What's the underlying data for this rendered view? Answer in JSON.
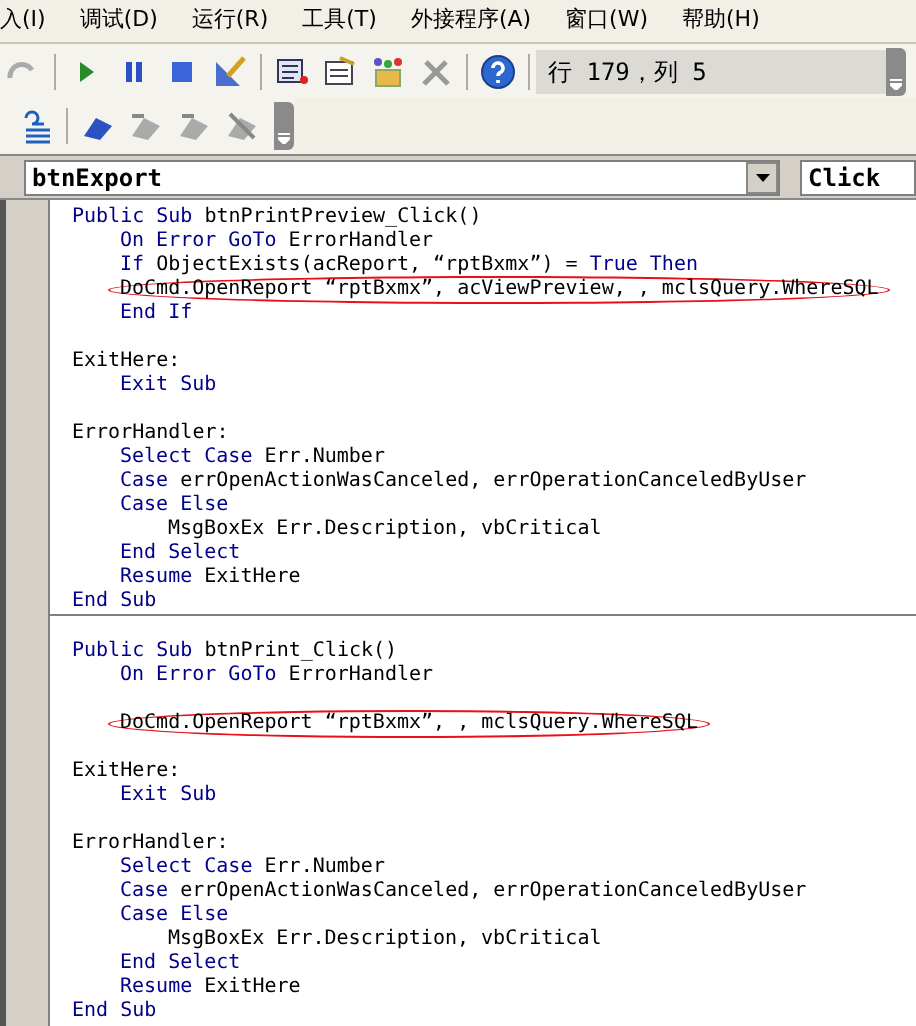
{
  "menu": [
    "入(I)",
    "调试(D)",
    "运行(R)",
    "工具(T)",
    "外接程序(A)",
    "窗口(W)",
    "帮助(H)"
  ],
  "toolbar": {
    "position": "行 179，列 5"
  },
  "object_combo": {
    "value": "btnExport"
  },
  "procedure_combo": {
    "value": "Click"
  },
  "procedures": [
    {
      "lines": [
        {
          "segments": [
            {
              "kind": "kw",
              "text": "Public Sub"
            },
            {
              "kind": "tx",
              "text": " btnPrintPreview_Click()"
            }
          ],
          "children": [
            {
              "segments": [
                {
                  "kind": "kw",
                  "text": "On Error GoTo"
                },
                {
                  "kind": "tx",
                  "text": " ErrorHandler"
                }
              ]
            },
            {
              "segments": [
                {
                  "kind": "kw",
                  "text": "If"
                },
                {
                  "kind": "tx",
                  "text": " ObjectExists(acReport, “rptBxmx”) = "
                },
                {
                  "kind": "kw",
                  "text": "True Then"
                }
              ]
            },
            {
              "circled": true,
              "segments": [
                {
                  "kind": "tx",
                  "text": "DoCmd.OpenReport “rptBxmx”, acViewPreview, , mclsQuery.WhereSQL"
                }
              ]
            },
            {
              "segments": [
                {
                  "kind": "kw",
                  "text": "End If"
                }
              ]
            }
          ]
        },
        {
          "blank_before": true,
          "segments": [
            {
              "kind": "tx",
              "text": "ExitHere:"
            }
          ],
          "children": [
            {
              "segments": [
                {
                  "kind": "kw",
                  "text": "Exit Sub"
                }
              ]
            }
          ]
        },
        {
          "blank_before": true,
          "segments": [
            {
              "kind": "tx",
              "text": "ErrorHandler:"
            }
          ],
          "children": [
            {
              "segments": [
                {
                  "kind": "kw",
                  "text": "Select Case"
                },
                {
                  "kind": "tx",
                  "text": " Err.Number"
                }
              ]
            },
            {
              "segments": [
                {
                  "kind": "kw",
                  "text": "Case"
                },
                {
                  "kind": "tx",
                  "text": " errOpenActionWasCanceled, errOperationCanceledByUser"
                }
              ]
            },
            {
              "segments": [
                {
                  "kind": "kw",
                  "text": "Case Else"
                }
              ],
              "children": [
                {
                  "segments": [
                    {
                      "kind": "tx",
                      "text": "MsgBoxEx Err.Description, vbCritical"
                    }
                  ]
                }
              ]
            },
            {
              "segments": [
                {
                  "kind": "kw",
                  "text": "End Select"
                }
              ]
            },
            {
              "segments": [
                {
                  "kind": "kw",
                  "text": "Resume"
                },
                {
                  "kind": "tx",
                  "text": " ExitHere"
                }
              ]
            }
          ]
        },
        {
          "segments": [
            {
              "kind": "kw",
              "text": "End Sub"
            }
          ]
        }
      ]
    },
    {
      "lines": [
        {
          "blank_before": true,
          "segments": [
            {
              "kind": "kw",
              "text": "Public Sub"
            },
            {
              "kind": "tx",
              "text": " btnPrint_Click()"
            }
          ],
          "children": [
            {
              "segments": [
                {
                  "kind": "kw",
                  "text": "On Error GoTo"
                },
                {
                  "kind": "tx",
                  "text": " ErrorHandler"
                }
              ]
            },
            {
              "blank_before": true,
              "circled": true,
              "segments": [
                {
                  "kind": "tx",
                  "text": "DoCmd.OpenReport “rptBxmx”, , mclsQuery.WhereSQL"
                }
              ]
            }
          ]
        },
        {
          "blank_before": true,
          "segments": [
            {
              "kind": "tx",
              "text": "ExitHere:"
            }
          ],
          "children": [
            {
              "segments": [
                {
                  "kind": "kw",
                  "text": "Exit Sub"
                }
              ]
            }
          ]
        },
        {
          "blank_before": true,
          "segments": [
            {
              "kind": "tx",
              "text": "ErrorHandler:"
            }
          ],
          "children": [
            {
              "segments": [
                {
                  "kind": "kw",
                  "text": "Select Case"
                },
                {
                  "kind": "tx",
                  "text": " Err.Number"
                }
              ]
            },
            {
              "segments": [
                {
                  "kind": "kw",
                  "text": "Case"
                },
                {
                  "kind": "tx",
                  "text": " errOpenActionWasCanceled, errOperationCanceledByUser"
                }
              ]
            },
            {
              "segments": [
                {
                  "kind": "kw",
                  "text": "Case Else"
                }
              ],
              "children": [
                {
                  "segments": [
                    {
                      "kind": "tx",
                      "text": "MsgBoxEx Err.Description, vbCritical"
                    }
                  ]
                }
              ]
            },
            {
              "segments": [
                {
                  "kind": "kw",
                  "text": "End Select"
                }
              ]
            },
            {
              "segments": [
                {
                  "kind": "kw",
                  "text": "Resume"
                },
                {
                  "kind": "tx",
                  "text": " ExitHere"
                }
              ]
            }
          ]
        },
        {
          "segments": [
            {
              "kind": "kw",
              "text": "End Sub"
            }
          ]
        }
      ]
    }
  ]
}
